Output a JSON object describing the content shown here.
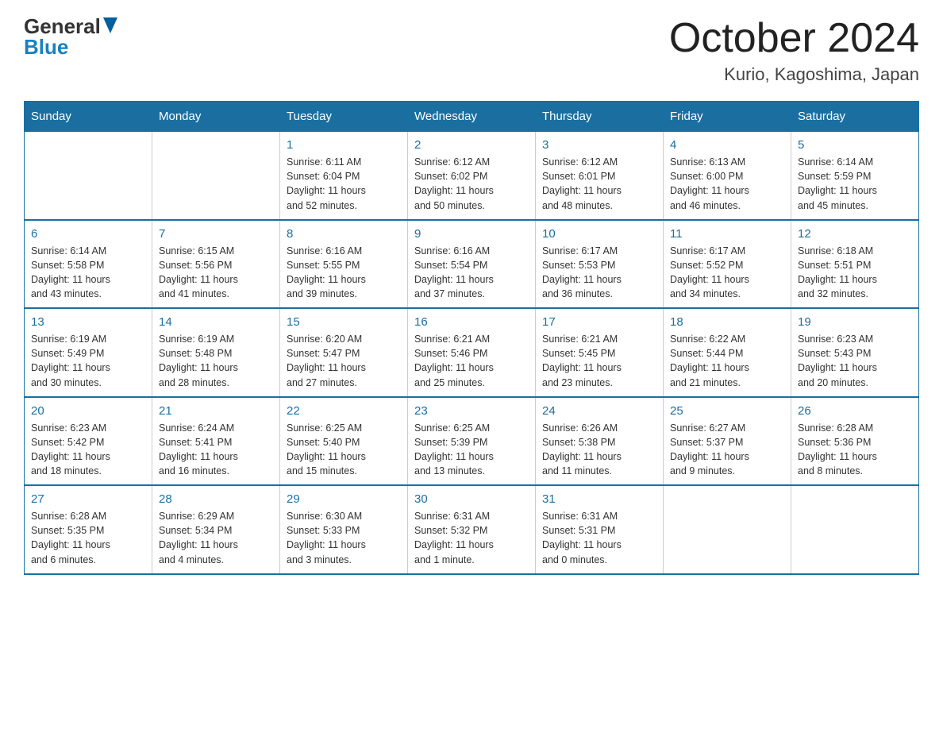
{
  "logo": {
    "general": "General",
    "blue": "Blue"
  },
  "title": "October 2024",
  "subtitle": "Kurio, Kagoshima, Japan",
  "days_of_week": [
    "Sunday",
    "Monday",
    "Tuesday",
    "Wednesday",
    "Thursday",
    "Friday",
    "Saturday"
  ],
  "weeks": [
    [
      {
        "day": "",
        "info": ""
      },
      {
        "day": "",
        "info": ""
      },
      {
        "day": "1",
        "info": "Sunrise: 6:11 AM\nSunset: 6:04 PM\nDaylight: 11 hours\nand 52 minutes."
      },
      {
        "day": "2",
        "info": "Sunrise: 6:12 AM\nSunset: 6:02 PM\nDaylight: 11 hours\nand 50 minutes."
      },
      {
        "day": "3",
        "info": "Sunrise: 6:12 AM\nSunset: 6:01 PM\nDaylight: 11 hours\nand 48 minutes."
      },
      {
        "day": "4",
        "info": "Sunrise: 6:13 AM\nSunset: 6:00 PM\nDaylight: 11 hours\nand 46 minutes."
      },
      {
        "day": "5",
        "info": "Sunrise: 6:14 AM\nSunset: 5:59 PM\nDaylight: 11 hours\nand 45 minutes."
      }
    ],
    [
      {
        "day": "6",
        "info": "Sunrise: 6:14 AM\nSunset: 5:58 PM\nDaylight: 11 hours\nand 43 minutes."
      },
      {
        "day": "7",
        "info": "Sunrise: 6:15 AM\nSunset: 5:56 PM\nDaylight: 11 hours\nand 41 minutes."
      },
      {
        "day": "8",
        "info": "Sunrise: 6:16 AM\nSunset: 5:55 PM\nDaylight: 11 hours\nand 39 minutes."
      },
      {
        "day": "9",
        "info": "Sunrise: 6:16 AM\nSunset: 5:54 PM\nDaylight: 11 hours\nand 37 minutes."
      },
      {
        "day": "10",
        "info": "Sunrise: 6:17 AM\nSunset: 5:53 PM\nDaylight: 11 hours\nand 36 minutes."
      },
      {
        "day": "11",
        "info": "Sunrise: 6:17 AM\nSunset: 5:52 PM\nDaylight: 11 hours\nand 34 minutes."
      },
      {
        "day": "12",
        "info": "Sunrise: 6:18 AM\nSunset: 5:51 PM\nDaylight: 11 hours\nand 32 minutes."
      }
    ],
    [
      {
        "day": "13",
        "info": "Sunrise: 6:19 AM\nSunset: 5:49 PM\nDaylight: 11 hours\nand 30 minutes."
      },
      {
        "day": "14",
        "info": "Sunrise: 6:19 AM\nSunset: 5:48 PM\nDaylight: 11 hours\nand 28 minutes."
      },
      {
        "day": "15",
        "info": "Sunrise: 6:20 AM\nSunset: 5:47 PM\nDaylight: 11 hours\nand 27 minutes."
      },
      {
        "day": "16",
        "info": "Sunrise: 6:21 AM\nSunset: 5:46 PM\nDaylight: 11 hours\nand 25 minutes."
      },
      {
        "day": "17",
        "info": "Sunrise: 6:21 AM\nSunset: 5:45 PM\nDaylight: 11 hours\nand 23 minutes."
      },
      {
        "day": "18",
        "info": "Sunrise: 6:22 AM\nSunset: 5:44 PM\nDaylight: 11 hours\nand 21 minutes."
      },
      {
        "day": "19",
        "info": "Sunrise: 6:23 AM\nSunset: 5:43 PM\nDaylight: 11 hours\nand 20 minutes."
      }
    ],
    [
      {
        "day": "20",
        "info": "Sunrise: 6:23 AM\nSunset: 5:42 PM\nDaylight: 11 hours\nand 18 minutes."
      },
      {
        "day": "21",
        "info": "Sunrise: 6:24 AM\nSunset: 5:41 PM\nDaylight: 11 hours\nand 16 minutes."
      },
      {
        "day": "22",
        "info": "Sunrise: 6:25 AM\nSunset: 5:40 PM\nDaylight: 11 hours\nand 15 minutes."
      },
      {
        "day": "23",
        "info": "Sunrise: 6:25 AM\nSunset: 5:39 PM\nDaylight: 11 hours\nand 13 minutes."
      },
      {
        "day": "24",
        "info": "Sunrise: 6:26 AM\nSunset: 5:38 PM\nDaylight: 11 hours\nand 11 minutes."
      },
      {
        "day": "25",
        "info": "Sunrise: 6:27 AM\nSunset: 5:37 PM\nDaylight: 11 hours\nand 9 minutes."
      },
      {
        "day": "26",
        "info": "Sunrise: 6:28 AM\nSunset: 5:36 PM\nDaylight: 11 hours\nand 8 minutes."
      }
    ],
    [
      {
        "day": "27",
        "info": "Sunrise: 6:28 AM\nSunset: 5:35 PM\nDaylight: 11 hours\nand 6 minutes."
      },
      {
        "day": "28",
        "info": "Sunrise: 6:29 AM\nSunset: 5:34 PM\nDaylight: 11 hours\nand 4 minutes."
      },
      {
        "day": "29",
        "info": "Sunrise: 6:30 AM\nSunset: 5:33 PM\nDaylight: 11 hours\nand 3 minutes."
      },
      {
        "day": "30",
        "info": "Sunrise: 6:31 AM\nSunset: 5:32 PM\nDaylight: 11 hours\nand 1 minute."
      },
      {
        "day": "31",
        "info": "Sunrise: 6:31 AM\nSunset: 5:31 PM\nDaylight: 11 hours\nand 0 minutes."
      },
      {
        "day": "",
        "info": ""
      },
      {
        "day": "",
        "info": ""
      }
    ]
  ]
}
